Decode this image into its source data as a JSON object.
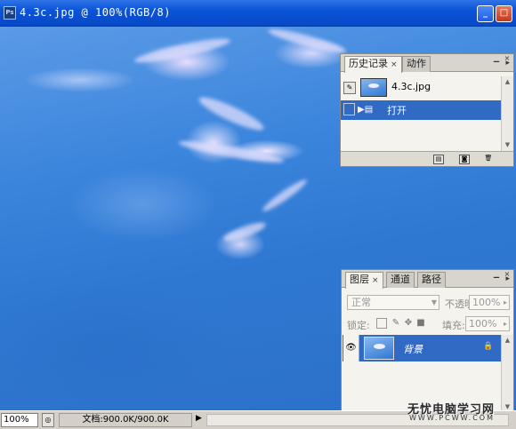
{
  "window": {
    "title": "4.3c.jpg @ 100%(RGB/8)",
    "app_icon_text": "Ps",
    "minimize": "_",
    "restore": "□",
    "close": "×"
  },
  "statusbar": {
    "zoom": "100%",
    "doc_info": "文档:900.0K/900.0K",
    "arrow": "▶"
  },
  "watermark": {
    "text": "无忧电脑学习网",
    "url": "WWW.PCWW.COM"
  },
  "history_panel": {
    "tabs": [
      {
        "label": "历史记录",
        "close": "×",
        "active": true
      },
      {
        "label": "动作",
        "active": false
      }
    ],
    "snapshot": {
      "label": "4.3c.jpg"
    },
    "states": [
      {
        "label": "打开",
        "selected": true
      }
    ],
    "menu": "▸"
  },
  "layers_panel": {
    "tabs": [
      {
        "label": "图层",
        "close": "×",
        "active": true
      },
      {
        "label": "通道",
        "active": false
      },
      {
        "label": "路径",
        "active": false
      }
    ],
    "blend_mode": "正常",
    "opacity_label": "不透明度:",
    "opacity_value": "100%",
    "lock_label": "锁定:",
    "fill_label": "填充:",
    "fill_value": "100%",
    "layers": [
      {
        "name": "背景",
        "visible": true,
        "locked": true
      }
    ],
    "menu": "▸",
    "bottom_icons": [
      "link-icon",
      "fx-icon",
      "mask-icon",
      "adjustment-icon",
      "group-icon",
      "new-layer-icon",
      "delete-icon"
    ]
  },
  "colors": {
    "title_bar": "#0a54d8",
    "selection": "#316ac5",
    "panel_bg": "#f4f3ee"
  }
}
